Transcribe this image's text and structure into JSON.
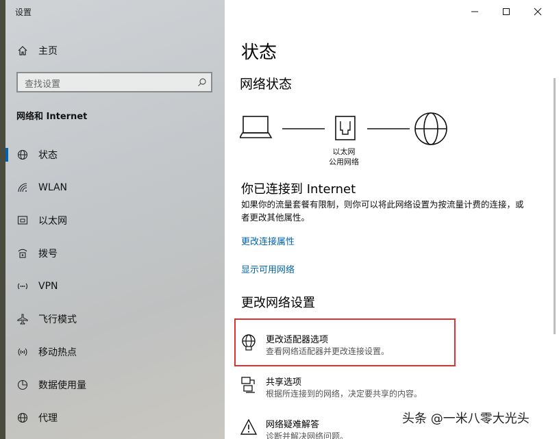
{
  "window": {
    "title": "设置"
  },
  "sidebar": {
    "home": "主页",
    "search_placeholder": "查找设置",
    "section": "网络和 Internet",
    "items": [
      {
        "label": "状态",
        "icon": "globe-icon",
        "active": true
      },
      {
        "label": "WLAN",
        "icon": "wifi-icon"
      },
      {
        "label": "以太网",
        "icon": "ethernet-icon"
      },
      {
        "label": "拨号",
        "icon": "dialup-icon"
      },
      {
        "label": "VPN",
        "icon": "vpn-icon"
      },
      {
        "label": "飞行模式",
        "icon": "airplane-icon"
      },
      {
        "label": "移动热点",
        "icon": "hotspot-icon"
      },
      {
        "label": "数据使用量",
        "icon": "data-usage-icon"
      },
      {
        "label": "代理",
        "icon": "proxy-globe-icon"
      }
    ]
  },
  "main": {
    "title": "状态",
    "network_status": "网络状态",
    "ethernet_label": "以太网",
    "network_type": "公用网络",
    "connected_heading": "你已连接到 Internet",
    "connected_desc": "如果你的流量套餐有限制，则你可以将此网络设置为按流量计费的连接，或者更改其他属性。",
    "link_change_props": "更改连接属性",
    "link_show_networks": "显示可用网络",
    "change_settings": "更改网络设置",
    "options": [
      {
        "title": "更改适配器选项",
        "desc": "查看网络适配器并更改连接设置。",
        "icon": "adapter-icon"
      },
      {
        "title": "共享选项",
        "desc": "根据所连接到的网络，决定要共享的内容。",
        "icon": "sharing-icon"
      },
      {
        "title": "网络疑难解答",
        "desc": "诊断并解决网络问题。",
        "icon": "warning-icon"
      }
    ]
  },
  "watermark": "头条 @一米八零大光头",
  "colors": {
    "accent": "#0063b1",
    "highlight": "#e0302f"
  }
}
